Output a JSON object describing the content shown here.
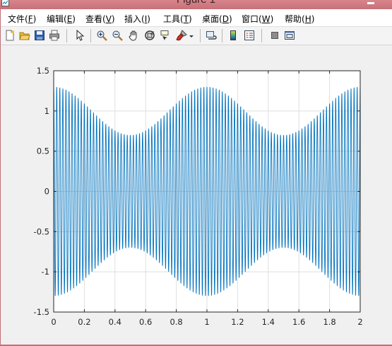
{
  "window": {
    "title": "Figure 1"
  },
  "menu": {
    "items": [
      {
        "text": "文件(",
        "key": "F",
        "close": ")"
      },
      {
        "text": "编辑(",
        "key": "E",
        "close": ")"
      },
      {
        "text": "查看(",
        "key": "V",
        "close": ")"
      },
      {
        "text": "插入(",
        "key": "I",
        "close": ")"
      },
      {
        "text": "工具(",
        "key": "T",
        "close": ")"
      },
      {
        "text": "桌面(",
        "key": "D",
        "close": ")"
      },
      {
        "text": "窗口(",
        "key": "W",
        "close": ")"
      },
      {
        "text": "帮助(",
        "key": "H",
        "close": ")"
      }
    ]
  },
  "toolbar": {
    "icons": [
      "new-figure-icon",
      "open-file-icon",
      "save-icon",
      "print-icon",
      "pointer-icon",
      "zoom-in-icon",
      "zoom-out-icon",
      "pan-icon",
      "rotate-3d-icon",
      "data-cursor-icon",
      "brush-icon",
      "brush-dropdown-icon",
      "link-plot-icon",
      "insert-colorbar-icon",
      "insert-legend-icon",
      "hide-plot-tools-icon",
      "show-plot-tools-icon"
    ]
  },
  "chart_data": {
    "type": "line",
    "function": "y = (1 + 0.3*cos(2*pi*x)) * cos(2*pi*50*x)",
    "series": [
      {
        "color": "#0072bd",
        "x_range": [
          0,
          2
        ],
        "carrier_cycles_per_unit": 50,
        "envelope_max": 1.3,
        "envelope_min": 0.7,
        "envelope_period": 1
      }
    ],
    "xlim": [
      0,
      2
    ],
    "ylim": [
      -1.5,
      1.5
    ],
    "xticks": [
      "0",
      "0.2",
      "0.4",
      "0.6",
      "0.8",
      "1",
      "1.2",
      "1.4",
      "1.6",
      "1.8",
      "2"
    ],
    "yticks": [
      "-1.5",
      "-1",
      "-0.5",
      "0",
      "0.5",
      "1",
      "1.5"
    ],
    "grid": true,
    "colors": {
      "line": "#0072bd",
      "grid": "#dfdfdf",
      "axes": "#262626"
    }
  }
}
